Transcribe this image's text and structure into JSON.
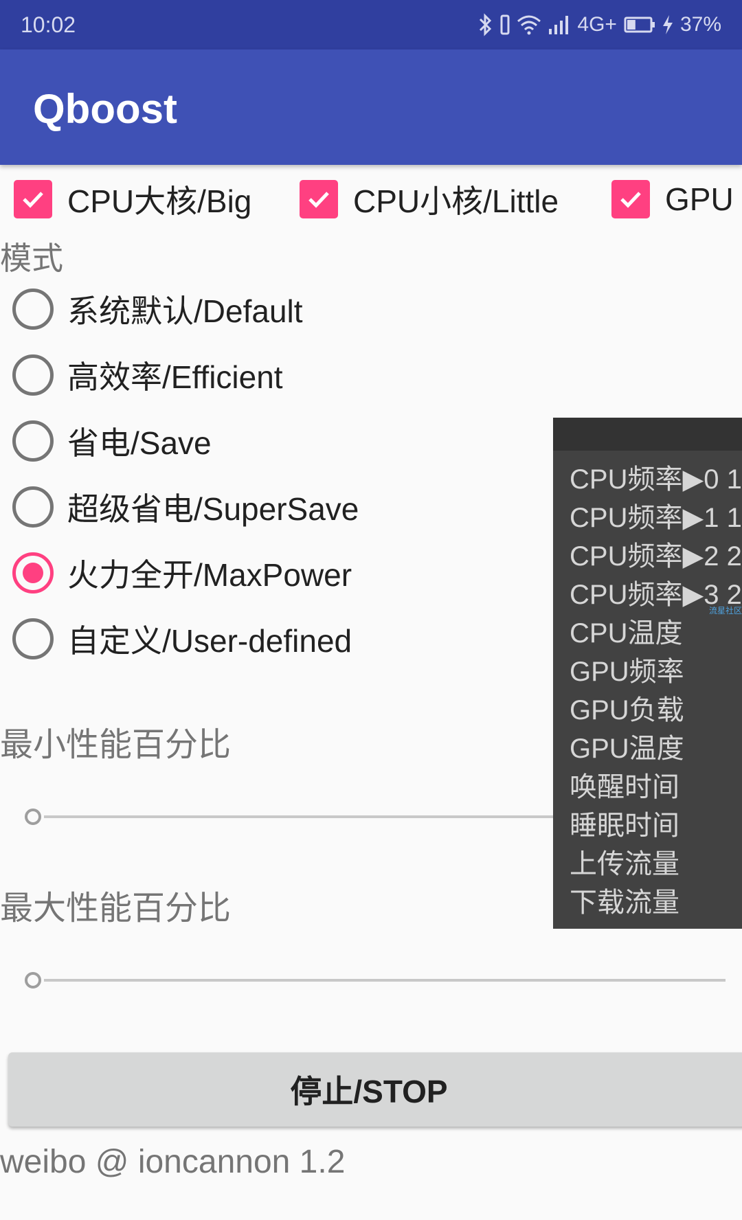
{
  "status_bar": {
    "time": "10:02",
    "network": "4G+",
    "battery": "37%",
    "battery_level": 0.37,
    "icons": [
      "bluetooth-icon",
      "vibrate-icon",
      "wifi-icon",
      "signal-icon",
      "battery-icon",
      "charging-icon"
    ]
  },
  "app_bar": {
    "title": "Qboost"
  },
  "checkboxes": [
    {
      "label": "CPU大核/Big",
      "checked": true
    },
    {
      "label": "CPU小核/Little",
      "checked": true
    },
    {
      "label": "GPU",
      "checked": true
    }
  ],
  "mode": {
    "label": "模式",
    "options": [
      {
        "label": "系统默认/Default",
        "selected": false
      },
      {
        "label": "高效率/Efficient",
        "selected": false
      },
      {
        "label": "省电/Save",
        "selected": false
      },
      {
        "label": "超级省电/SuperSave",
        "selected": false
      },
      {
        "label": "火力全开/MaxPower",
        "selected": true
      },
      {
        "label": "自定义/User-defined",
        "selected": false
      }
    ]
  },
  "min_perf": {
    "label": "最小性能百分比",
    "value": 0
  },
  "max_perf": {
    "label": "最大性能百分比",
    "value": 0
  },
  "overlay": {
    "items": [
      "CPU频率▶0  1",
      "CPU频率▶1  1",
      "CPU频率▶2  2",
      "CPU频率▶3  2",
      "CPU温度",
      "GPU频率",
      "GPU负载",
      "GPU温度",
      "唤醒时间",
      "睡眠时间",
      "上传流量",
      "下载流量"
    ],
    "watermark": "流星社区"
  },
  "stop_button": {
    "label": "停止/STOP"
  },
  "footer": {
    "text": "weibo @ ioncannon 1.2"
  },
  "colors": {
    "primary": "#3F51B5",
    "primary_dark": "#303F9F",
    "accent": "#FF4081"
  }
}
